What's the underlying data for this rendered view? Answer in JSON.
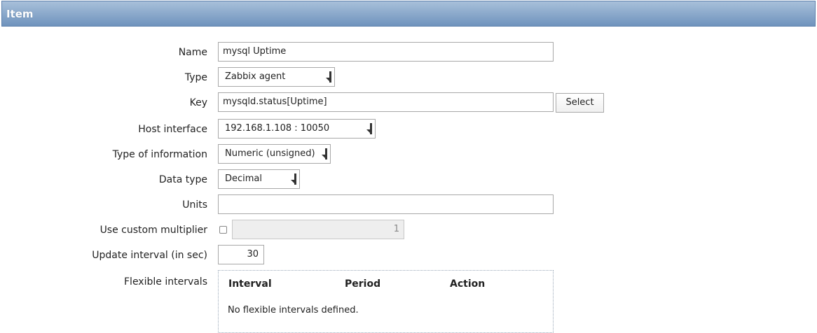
{
  "header": {
    "title": "Item"
  },
  "form": {
    "name": {
      "label": "Name",
      "value": "mysql Uptime"
    },
    "type": {
      "label": "Type",
      "value": "Zabbix agent"
    },
    "key": {
      "label": "Key",
      "value": "mysqld.status[Uptime]",
      "select_label": "Select"
    },
    "host_interface": {
      "label": "Host interface",
      "value": "192.168.1.108 : 10050"
    },
    "type_of_information": {
      "label": "Type of information",
      "value": "Numeric (unsigned)"
    },
    "data_type": {
      "label": "Data type",
      "value": "Decimal"
    },
    "units": {
      "label": "Units",
      "value": ""
    },
    "custom_multiplier": {
      "label": "Use custom multiplier",
      "checked": false,
      "value": "1"
    },
    "update_interval": {
      "label": "Update interval (in sec)",
      "value": "30"
    },
    "flexible_intervals": {
      "label": "Flexible intervals",
      "columns": [
        "Interval",
        "Period",
        "Action"
      ],
      "empty_text": "No flexible intervals defined."
    }
  },
  "colors": {
    "header_top": "#a8c0da",
    "header_bottom": "#6f93bd",
    "disabled_field": "#eeeeee"
  }
}
